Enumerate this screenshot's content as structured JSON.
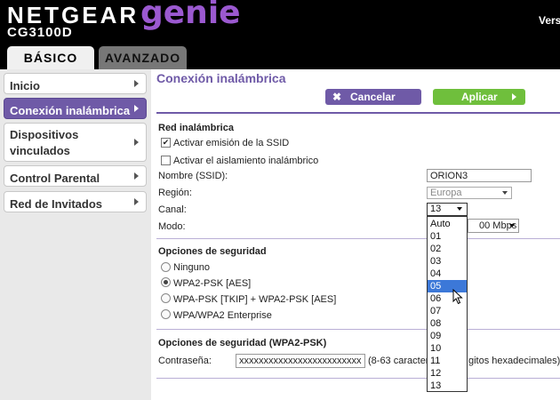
{
  "header": {
    "brand": "NETGEAR",
    "product": "genie",
    "trademark": "™",
    "model": "CG3100D",
    "version_partial": "Vers",
    "tabs": [
      {
        "label": "BÁSICO",
        "active": true
      },
      {
        "label": "AVANZADO",
        "active": false
      }
    ]
  },
  "sidebar": {
    "items": [
      {
        "label": "Inicio",
        "active": false
      },
      {
        "label": "Conexión inalámbrica",
        "active": true
      },
      {
        "label_line1": "Dispositivos",
        "label_line2": "vinculados",
        "active": false
      },
      {
        "label": "Control Parental",
        "active": false
      },
      {
        "label": "Red de Invitados",
        "active": false
      }
    ]
  },
  "main": {
    "title": "Conexión inalámbrica",
    "cancel_label": "Cancelar",
    "apply_label": "Aplicar",
    "wireless": {
      "section_title": "Red inalámbrica",
      "enable_ssid_label": "Activar emisión de la SSID",
      "enable_ssid_checked": true,
      "isolation_label": "Activar el aislamiento inalámbrico",
      "isolation_checked": false,
      "ssid_label": "Nombre (SSID):",
      "ssid_value": "ORION3",
      "region_label": "Región:",
      "region_value": "Europa",
      "channel_label": "Canal:",
      "channel_value": "13",
      "mode_label": "Modo:",
      "mode_value": "00 Mbps"
    },
    "channel_options": [
      "Auto",
      "01",
      "02",
      "03",
      "04",
      "05",
      "06",
      "07",
      "08",
      "09",
      "10",
      "11",
      "12",
      "13"
    ],
    "channel_highlighted": "05",
    "security": {
      "section_title": "Opciones de seguridad",
      "options": [
        {
          "label": "Ninguno",
          "selected": false
        },
        {
          "label": "WPA2-PSK [AES]",
          "selected": true
        },
        {
          "label": "WPA-PSK [TKIP] + WPA2-PSK [AES]",
          "selected": false
        },
        {
          "label": "WPA/WPA2 Enterprise",
          "selected": false
        }
      ]
    },
    "security_psk": {
      "section_title": "Opciones de seguridad (WPA2-PSK)",
      "password_label": "Contraseña:",
      "password_value": "xxxxxxxxxxxxxxxxxxxxxxxxx",
      "hint_prefix": "(8-63 caractere",
      "hint_suffix": "gitos hexadecimales)"
    }
  },
  "colors": {
    "accent_purple": "#6f5aa7",
    "apply_green": "#6fbf3c",
    "header_bg": "#000000",
    "genie_purple": "#9b59d0",
    "highlight_blue": "#3c78d8"
  }
}
